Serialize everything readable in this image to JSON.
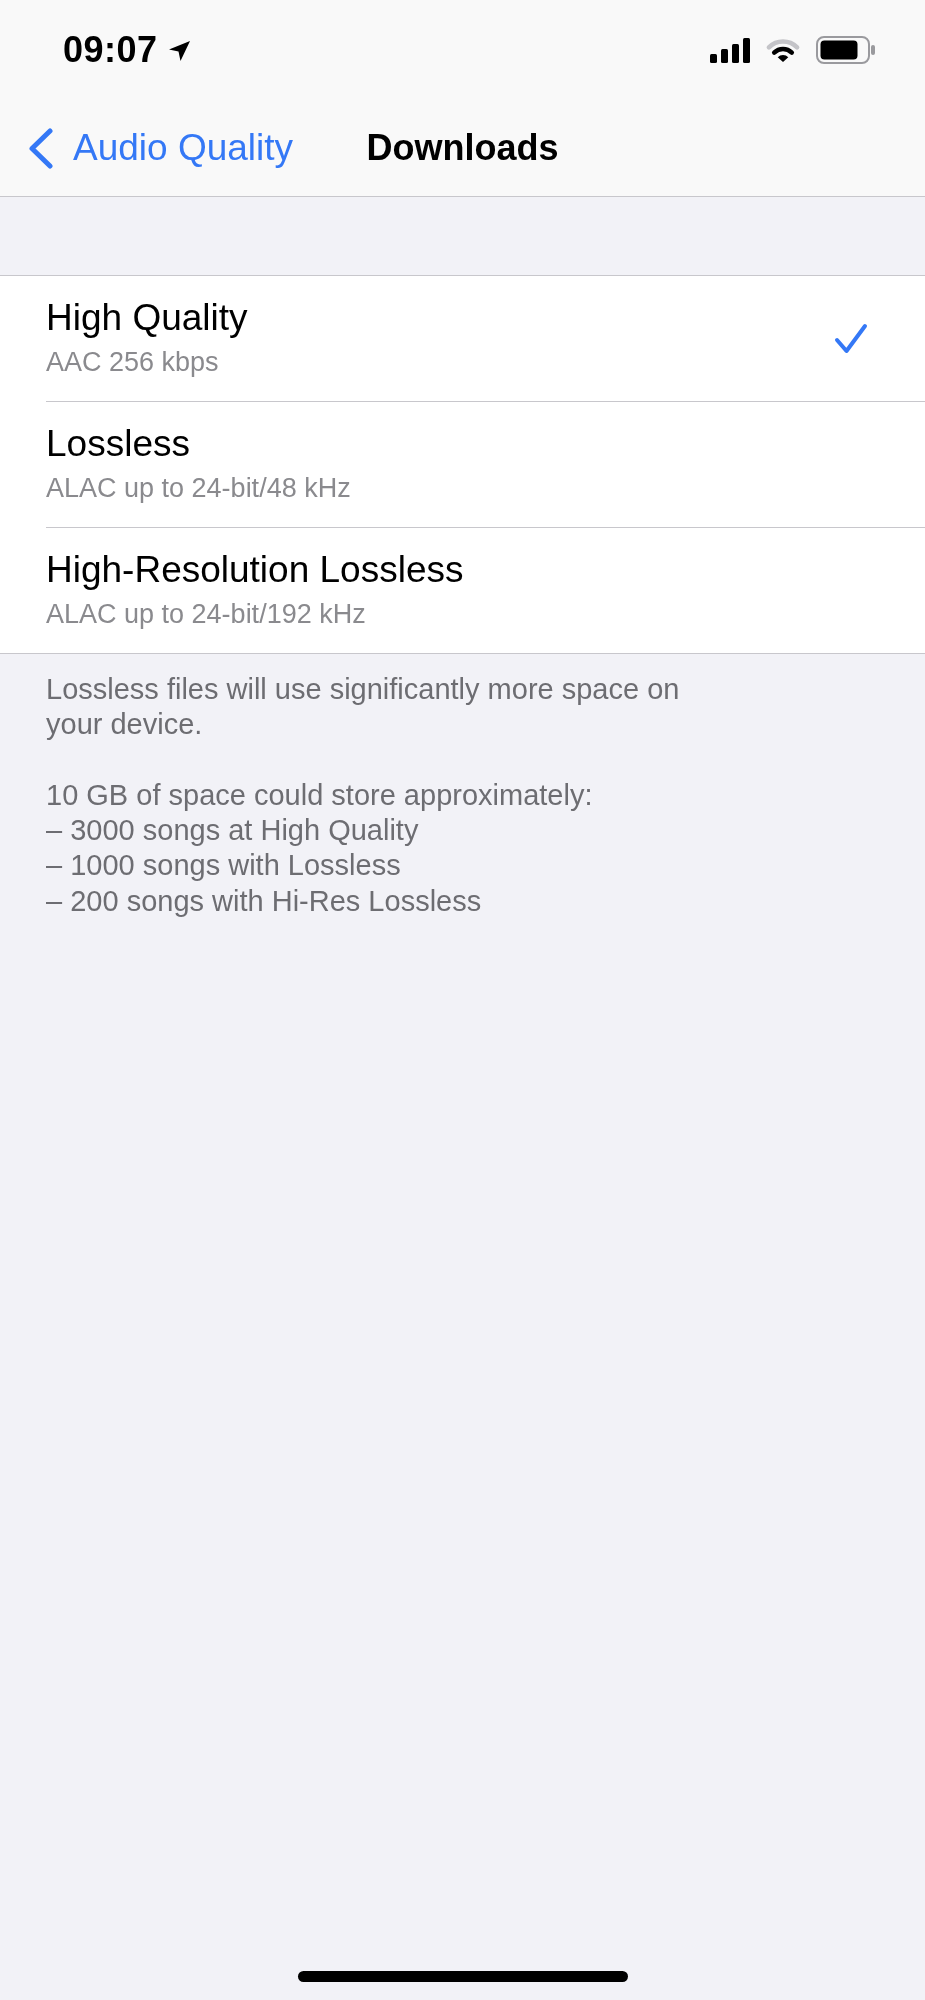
{
  "status_bar": {
    "time": "09:07"
  },
  "nav_bar": {
    "back_label": "Audio Quality",
    "title": "Downloads"
  },
  "options": [
    {
      "title": "High Quality",
      "detail": "AAC 256 kbps",
      "selected": true
    },
    {
      "title": "Lossless",
      "detail": "ALAC up to 24-bit/48 kHz",
      "selected": false
    },
    {
      "title": "High-Resolution Lossless",
      "detail": "ALAC up to 24-bit/192 kHz",
      "selected": false
    }
  ],
  "footer": {
    "note": "Lossless files will use significantly more space on your device.",
    "estimate_heading": "10 GB of space could store approximately:",
    "estimates": [
      "– 3000 songs at High Quality",
      "– 1000 songs with Lossless",
      "– 200 songs with Hi-Res Lossless"
    ]
  }
}
